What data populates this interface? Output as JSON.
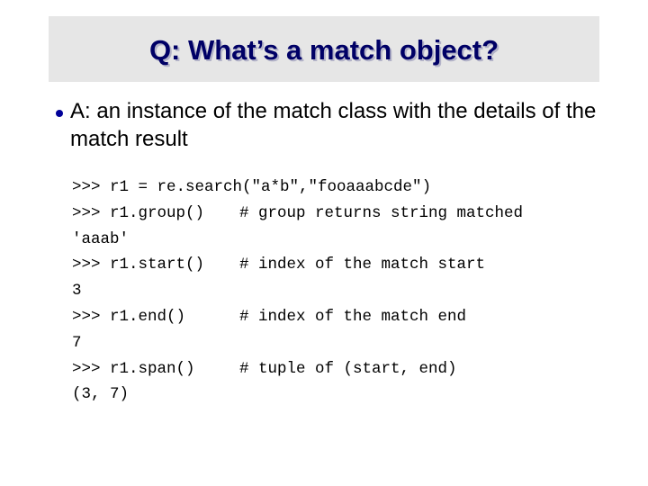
{
  "slide": {
    "title": "Q: What’s a match object?",
    "bullets": [
      {
        "icon": "bullet-dot-icon",
        "text": "A: an instance of the match class with the details of the match result"
      }
    ],
    "code": [
      {
        "type": "input",
        "command": ">>> r1 = re.search(\"a*b\",\"fooaaabcde\")",
        "comment": ""
      },
      {
        "type": "input",
        "command": ">>> r1.group()",
        "comment": "# group returns string matched"
      },
      {
        "type": "output",
        "command": "'aaab'",
        "comment": ""
      },
      {
        "type": "input",
        "command": ">>> r1.start()",
        "comment": "# index of the match start"
      },
      {
        "type": "output",
        "command": "3",
        "comment": ""
      },
      {
        "type": "input",
        "command": ">>> r1.end()",
        "comment": "# index of the match end"
      },
      {
        "type": "output",
        "command": "7",
        "comment": ""
      },
      {
        "type": "input",
        "command": ">>> r1.span()",
        "comment": "# tuple of (start, end)"
      },
      {
        "type": "output",
        "command": "(3, 7)",
        "comment": ""
      }
    ]
  },
  "colors": {
    "title_text": "#000066",
    "title_background": "#e6e6e6",
    "bullet": "#000099",
    "body_text": "#000000"
  }
}
